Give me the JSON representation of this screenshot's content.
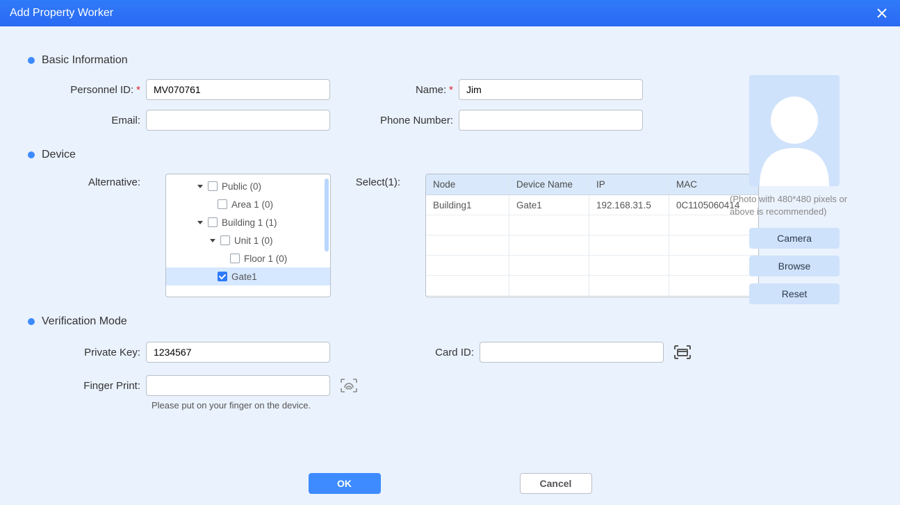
{
  "title": "Add Property Worker",
  "sections": {
    "basic": "Basic Information",
    "device": "Device",
    "verify": "Verification Mode"
  },
  "labels": {
    "personnel_id": "Personnel ID:",
    "name": "Name:",
    "email": "Email:",
    "phone": "Phone Number:",
    "alternative": "Alternative:",
    "select": "Select(1):",
    "private_key": "Private Key:",
    "card_id": "Card ID:",
    "fingerprint": "Finger Print:"
  },
  "values": {
    "personnel_id": "MV070761",
    "name": "Jim",
    "email": "",
    "phone": "",
    "private_key": "1234567",
    "card_id": "",
    "fingerprint": ""
  },
  "tree": {
    "public": "Public (0)",
    "area1": "Area 1 (0)",
    "building1": "Building 1 (1)",
    "unit1": "Unit 1 (0)",
    "floor1": "Floor 1 (0)",
    "gate1": "Gate1"
  },
  "table": {
    "headers": {
      "node": "Node",
      "device": "Device Name",
      "ip": "IP",
      "mac": "MAC"
    },
    "rows": [
      {
        "node": "Building1",
        "device": "Gate1",
        "ip": "192.168.31.5",
        "mac": "0C1105060414"
      }
    ]
  },
  "photo": {
    "hint": "(Photo with 480*480 pixels or above is recommended)",
    "camera": "Camera",
    "browse": "Browse",
    "reset": "Reset"
  },
  "hints": {
    "fingerprint": "Please put on your finger on the device."
  },
  "footer": {
    "ok": "OK",
    "cancel": "Cancel"
  }
}
